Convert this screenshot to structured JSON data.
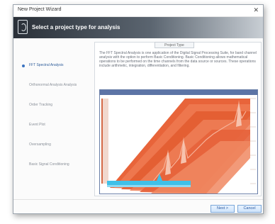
{
  "window": {
    "title": "New Project Wizard",
    "close_glyph": "✕"
  },
  "banner": {
    "title": "Select a project type for analysis"
  },
  "project_types": [
    {
      "label": "FFT Spectral Analysis",
      "selected": true
    },
    {
      "label": "Orthonormal Analysis Analysis",
      "selected": false
    },
    {
      "label": "Order Tracking",
      "selected": false
    },
    {
      "label": "Event Plot",
      "selected": false
    },
    {
      "label": "Oversampling",
      "selected": false
    },
    {
      "label": "Basic Signal Conditioning",
      "selected": false
    }
  ],
  "panel": {
    "tab_label": "Project Type",
    "description": "The FFT Spectral Analysis is one application of the Digital Signal Processing Suite, for band channel analysis with the option to perform Basic Conditioning. Basic Conditioning allows mathematical operations to be performed on the time channels from the data source or sources. These operations include arithmetic, integration, differentiation, and filtering."
  },
  "buttons": {
    "next": "Next >",
    "cancel": "Cancel"
  },
  "colors": {
    "accent": "#3a72c0",
    "surface_orange": "#e8643a",
    "surface_highlight": "#f6b39a",
    "baseline_cyan": "#3fc0e8"
  }
}
